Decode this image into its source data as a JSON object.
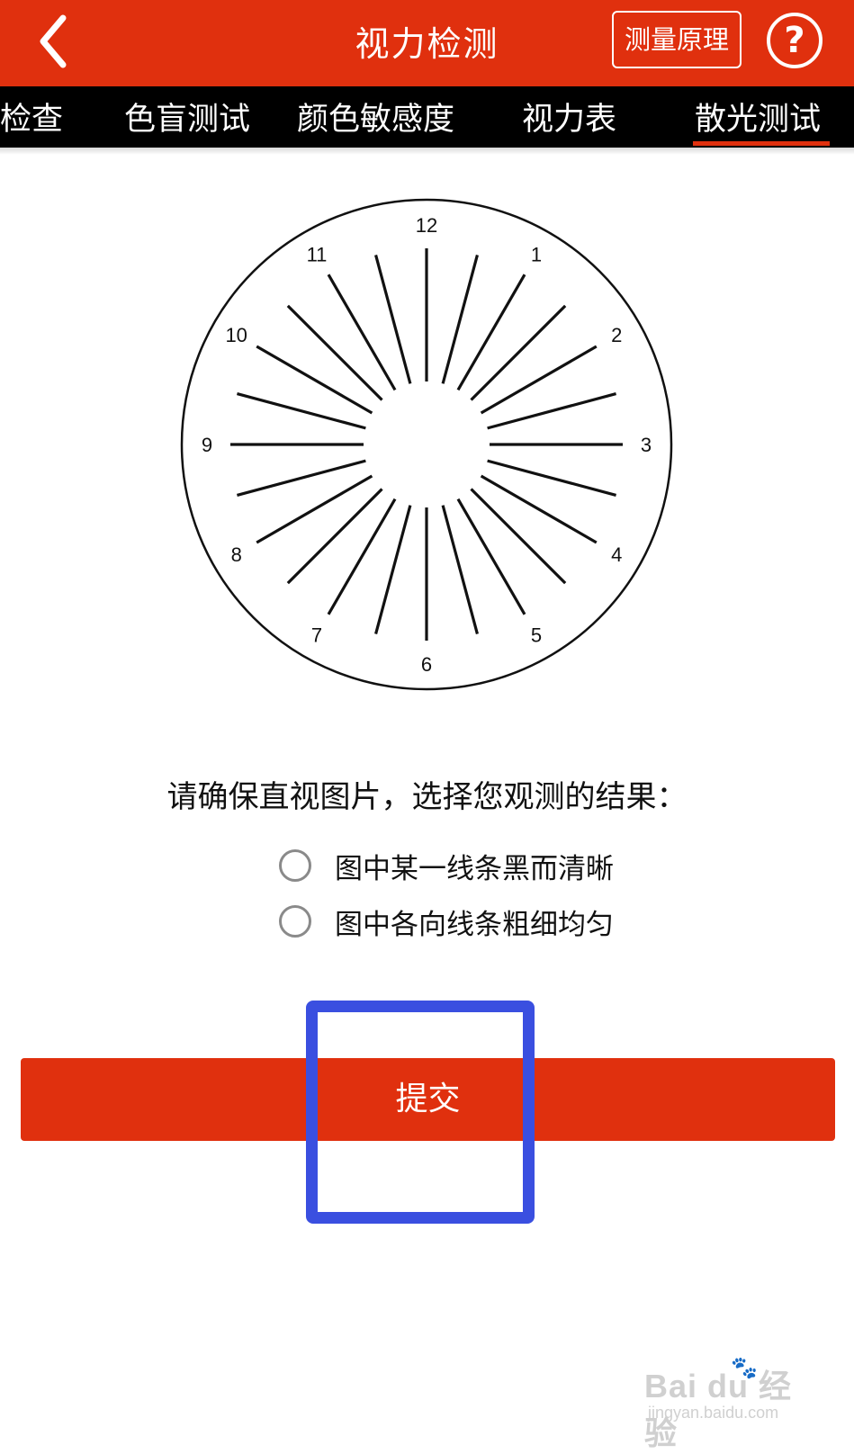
{
  "header": {
    "title": "视力检测",
    "principle_button": "测量原理",
    "help_glyph": "?"
  },
  "tabs": [
    {
      "label": "检查"
    },
    {
      "label": "色盲测试"
    },
    {
      "label": "颜色敏感度"
    },
    {
      "label": "视力表"
    },
    {
      "label": "散光测试",
      "selected": true
    }
  ],
  "astigmatism_chart": {
    "hour_labels": [
      "12",
      "1",
      "2",
      "3",
      "4",
      "5",
      "6",
      "7",
      "8",
      "9",
      "10",
      "11"
    ]
  },
  "question": {
    "prompt": "请确保直视图片，选择您观测的结果：",
    "options": [
      {
        "label": "图中某一线条黑而清晰",
        "selected": false
      },
      {
        "label": "图中各向线条粗细均匀",
        "selected": false
      }
    ]
  },
  "submit_label": "提交",
  "watermark": {
    "logo": "Bai du 经验",
    "url": "jingyan.baidu.com"
  },
  "colors": {
    "brand_red": "#e0300e",
    "tab_bar": "#000000",
    "highlight_blue": "#3a4fe0"
  }
}
